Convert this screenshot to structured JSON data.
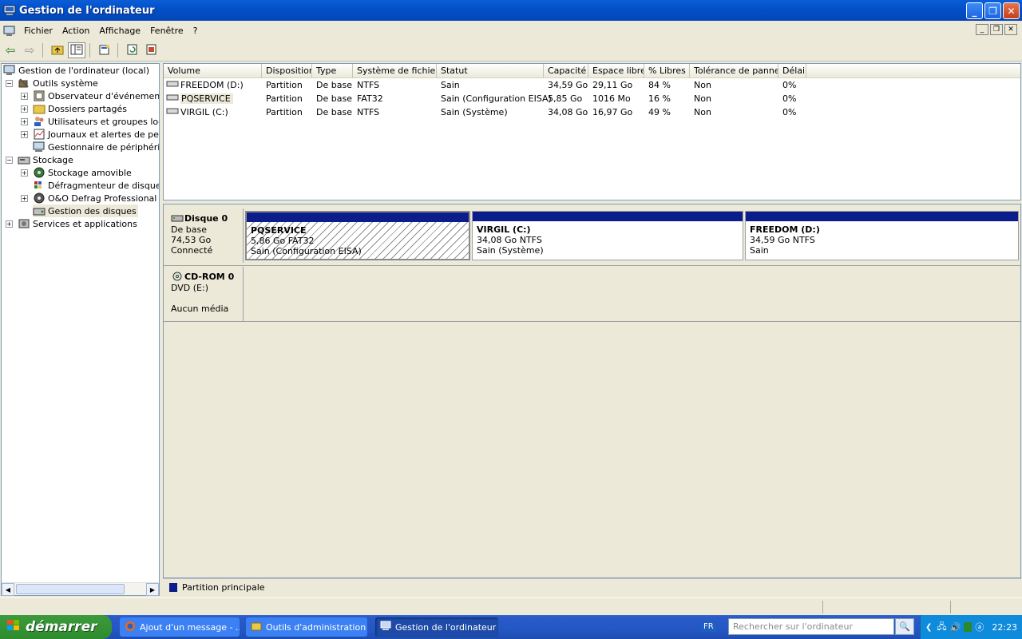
{
  "window": {
    "title": "Gestion de l'ordinateur"
  },
  "menu": [
    "Fichier",
    "Action",
    "Affichage",
    "Fenêtre",
    "?"
  ],
  "toolbar": [
    "back-icon",
    "forward-icon",
    "up-folder-icon",
    "show-tree-icon",
    "properties-icon",
    "refresh-icon",
    "help-icon"
  ],
  "tree": {
    "root": "Gestion de l'ordinateur (local)",
    "outils": "Outils système",
    "observateur": "Observateur d'événements",
    "dossiers": "Dossiers partagés",
    "utilisateurs": "Utilisateurs et groupes locau:",
    "journaux": "Journaux et alertes de perfo",
    "gestionnaire": "Gestionnaire de périphérique",
    "stockage": "Stockage",
    "amovible": "Stockage amovible",
    "defrag": "Défragmenteur de disque",
    "oo": "O&O Defrag Professional Edi",
    "disques": "Gestion des disques",
    "services": "Services et applications"
  },
  "columns": [
    "Volume",
    "Disposition",
    "Type",
    "Système de fichiers",
    "Statut",
    "Capacité",
    "Espace libre",
    "% Libres",
    "Tolérance de pannes",
    "Délai"
  ],
  "rows": [
    [
      "FREEDOM (D:)",
      "Partition",
      "De base",
      "NTFS",
      "Sain",
      "34,59 Go",
      "29,11 Go",
      "84 %",
      "Non",
      "0%"
    ],
    [
      "PQSERVICE",
      "Partition",
      "De base",
      "FAT32",
      "Sain (Configuration EISA)",
      "5,85 Go",
      "1016 Mo",
      "16 %",
      "Non",
      "0%"
    ],
    [
      "VIRGIL (C:)",
      "Partition",
      "De base",
      "NTFS",
      "Sain (Système)",
      "34,08 Go",
      "16,97 Go",
      "49 %",
      "Non",
      "0%"
    ]
  ],
  "disk0": {
    "name": "Disque 0",
    "type": "De base",
    "size": "74,53 Go",
    "status": "Connecté"
  },
  "partitions": [
    {
      "name": "PQSERVICE",
      "size": "5,86 Go FAT32",
      "status": "Sain (Configuration EISA)"
    },
    {
      "name": "VIRGIL  (C:)",
      "size": "34,08 Go NTFS",
      "status": "Sain (Système)"
    },
    {
      "name": "FREEDOM  (D:)",
      "size": "34,59 Go NTFS",
      "status": "Sain"
    }
  ],
  "cdrom": {
    "name": "CD-ROM 0",
    "drive": "DVD (E:)",
    "media": "Aucun média"
  },
  "legend": "Partition principale",
  "taskbar": {
    "start": "démarrer",
    "tasks": [
      "Ajout d'un message - ...",
      "Outils d'administration",
      "Gestion de l'ordinateur"
    ],
    "lang": "FR",
    "search_placeholder": "Rechercher sur l'ordinateur",
    "clock": "22:23"
  },
  "colors": {
    "partition_bar": "#0a1d8a",
    "titlebar": "#0350c8"
  }
}
